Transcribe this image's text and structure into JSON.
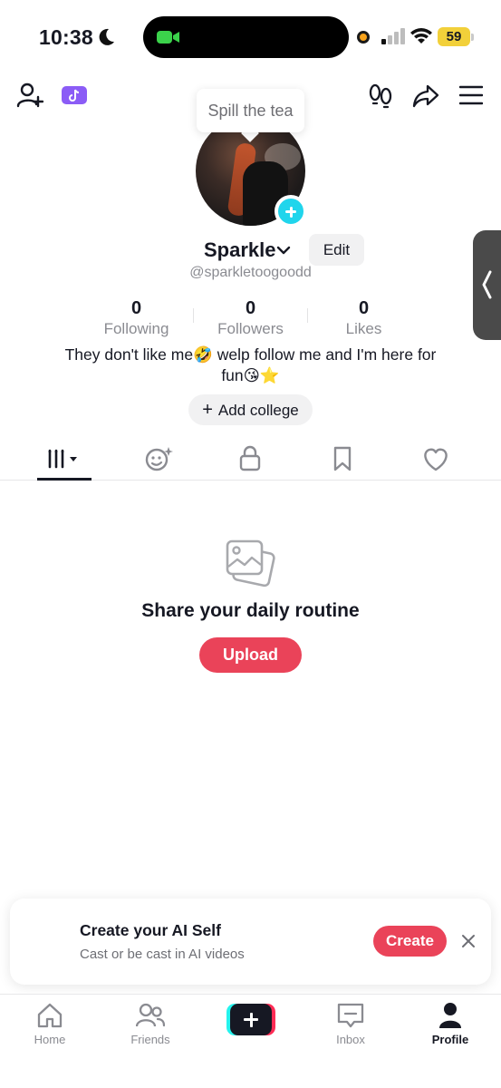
{
  "status_bar": {
    "time": "10:38",
    "battery": "59"
  },
  "header": {
    "tooltip": "Spill the tea"
  },
  "profile": {
    "name": "Sparkle",
    "edit_label": "Edit",
    "handle": "@sparkletoogoodd",
    "stats": [
      {
        "value": "0",
        "label": "Following"
      },
      {
        "value": "0",
        "label": "Followers"
      },
      {
        "value": "0",
        "label": "Likes"
      }
    ],
    "bio_line1": "They don't like me🤣 welp follow me and I'm here for",
    "bio_line2": "fun😘⭐",
    "add_college_label": "Add college"
  },
  "tabs": [
    "videos-grid",
    "reposts",
    "private",
    "saved",
    "liked"
  ],
  "empty_state": {
    "title": "Share your daily routine",
    "button": "Upload"
  },
  "ai_banner": {
    "title": "Create your AI Self",
    "subtitle": "Cast or be cast in AI videos",
    "button": "Create"
  },
  "bottom_nav": {
    "home": "Home",
    "friends": "Friends",
    "inbox": "Inbox",
    "profile": "Profile"
  },
  "colors": {
    "accent": "#ea4359",
    "badge": "#20d5ec",
    "battery": "#f2d03a"
  }
}
